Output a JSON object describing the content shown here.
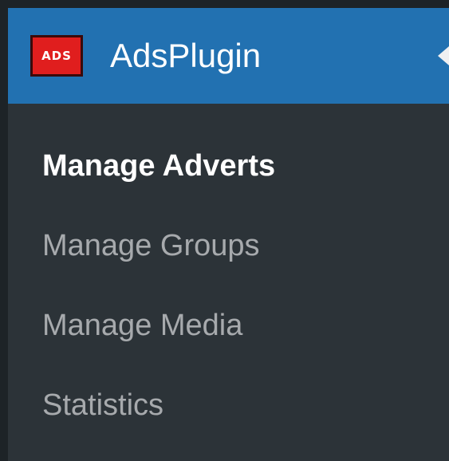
{
  "menu": {
    "title": "AdsPlugin",
    "logo_text": "ADS",
    "logo_icon": "ads-logo-icon",
    "colors": {
      "header_bg": "#2271b1",
      "menu_bg": "#2c3338",
      "logo_bg": "#e01e1e",
      "active_text": "#ffffff",
      "inactive_text": "#a7aaad"
    },
    "items": [
      {
        "label": "Manage Adverts",
        "current": true
      },
      {
        "label": "Manage Groups",
        "current": false
      },
      {
        "label": "Manage Media",
        "current": false
      },
      {
        "label": "Statistics",
        "current": false
      }
    ]
  }
}
